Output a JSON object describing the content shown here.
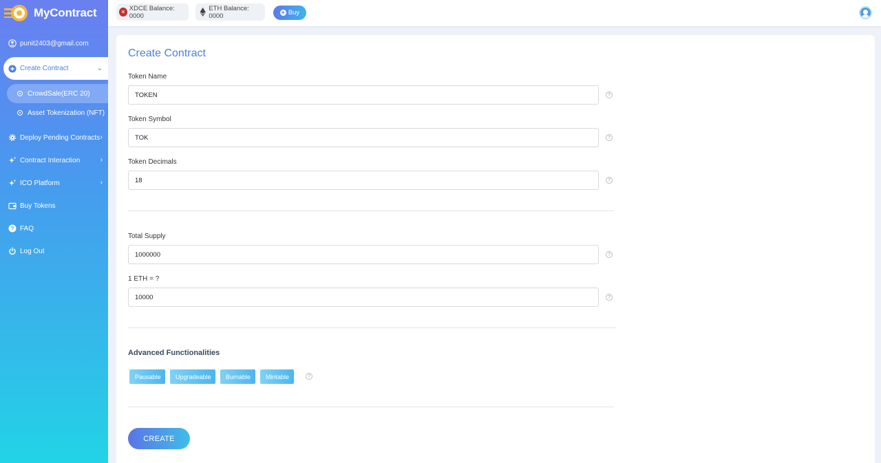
{
  "brand": {
    "name": "MyContract"
  },
  "user": {
    "email": "punit2403@gmail.com"
  },
  "sidebar": {
    "items": [
      {
        "label": "Create Contract",
        "icon": "plus-circle-icon"
      },
      {
        "label": "Deploy Pending Contracts",
        "icon": "gear-icon"
      },
      {
        "label": "Contract Interaction",
        "icon": "sparkle-icon"
      },
      {
        "label": "ICO Platform",
        "icon": "sparkle-icon"
      },
      {
        "label": "Buy Tokens",
        "icon": "wallet-icon"
      },
      {
        "label": "FAQ",
        "icon": "question-icon"
      },
      {
        "label": "Log Out",
        "icon": "power-icon"
      }
    ],
    "subitems": [
      {
        "label": "CrowdSale(ERC 20)"
      },
      {
        "label": "Asset Tokenization (NFT)"
      }
    ]
  },
  "topbar": {
    "xdce_balance": "XDCE Balance: 0000",
    "eth_balance": "ETH Balance: 0000",
    "buy_label": "Buy"
  },
  "form": {
    "title": "Create Contract",
    "fields": [
      {
        "label": "Token Name",
        "value": "TOKEN"
      },
      {
        "label": "Token Symbol",
        "value": "TOK"
      },
      {
        "label": "Token Decimals",
        "value": "18"
      },
      {
        "label": "Total Supply",
        "value": "1000000"
      },
      {
        "label": "1 ETH = ?",
        "value": "10000"
      }
    ],
    "help_glyph": "?",
    "advanced_title": "Advanced Functionalities",
    "features": [
      "Pausable",
      "Upgradeable",
      "Burnable",
      "Mintable"
    ],
    "create_label": "CREATE"
  },
  "colors": {
    "accent": "#4a7fe0",
    "sidebar_top": "#6a7ff0",
    "sidebar_bottom": "#22d3e6",
    "xdc_red": "#c2302b"
  }
}
